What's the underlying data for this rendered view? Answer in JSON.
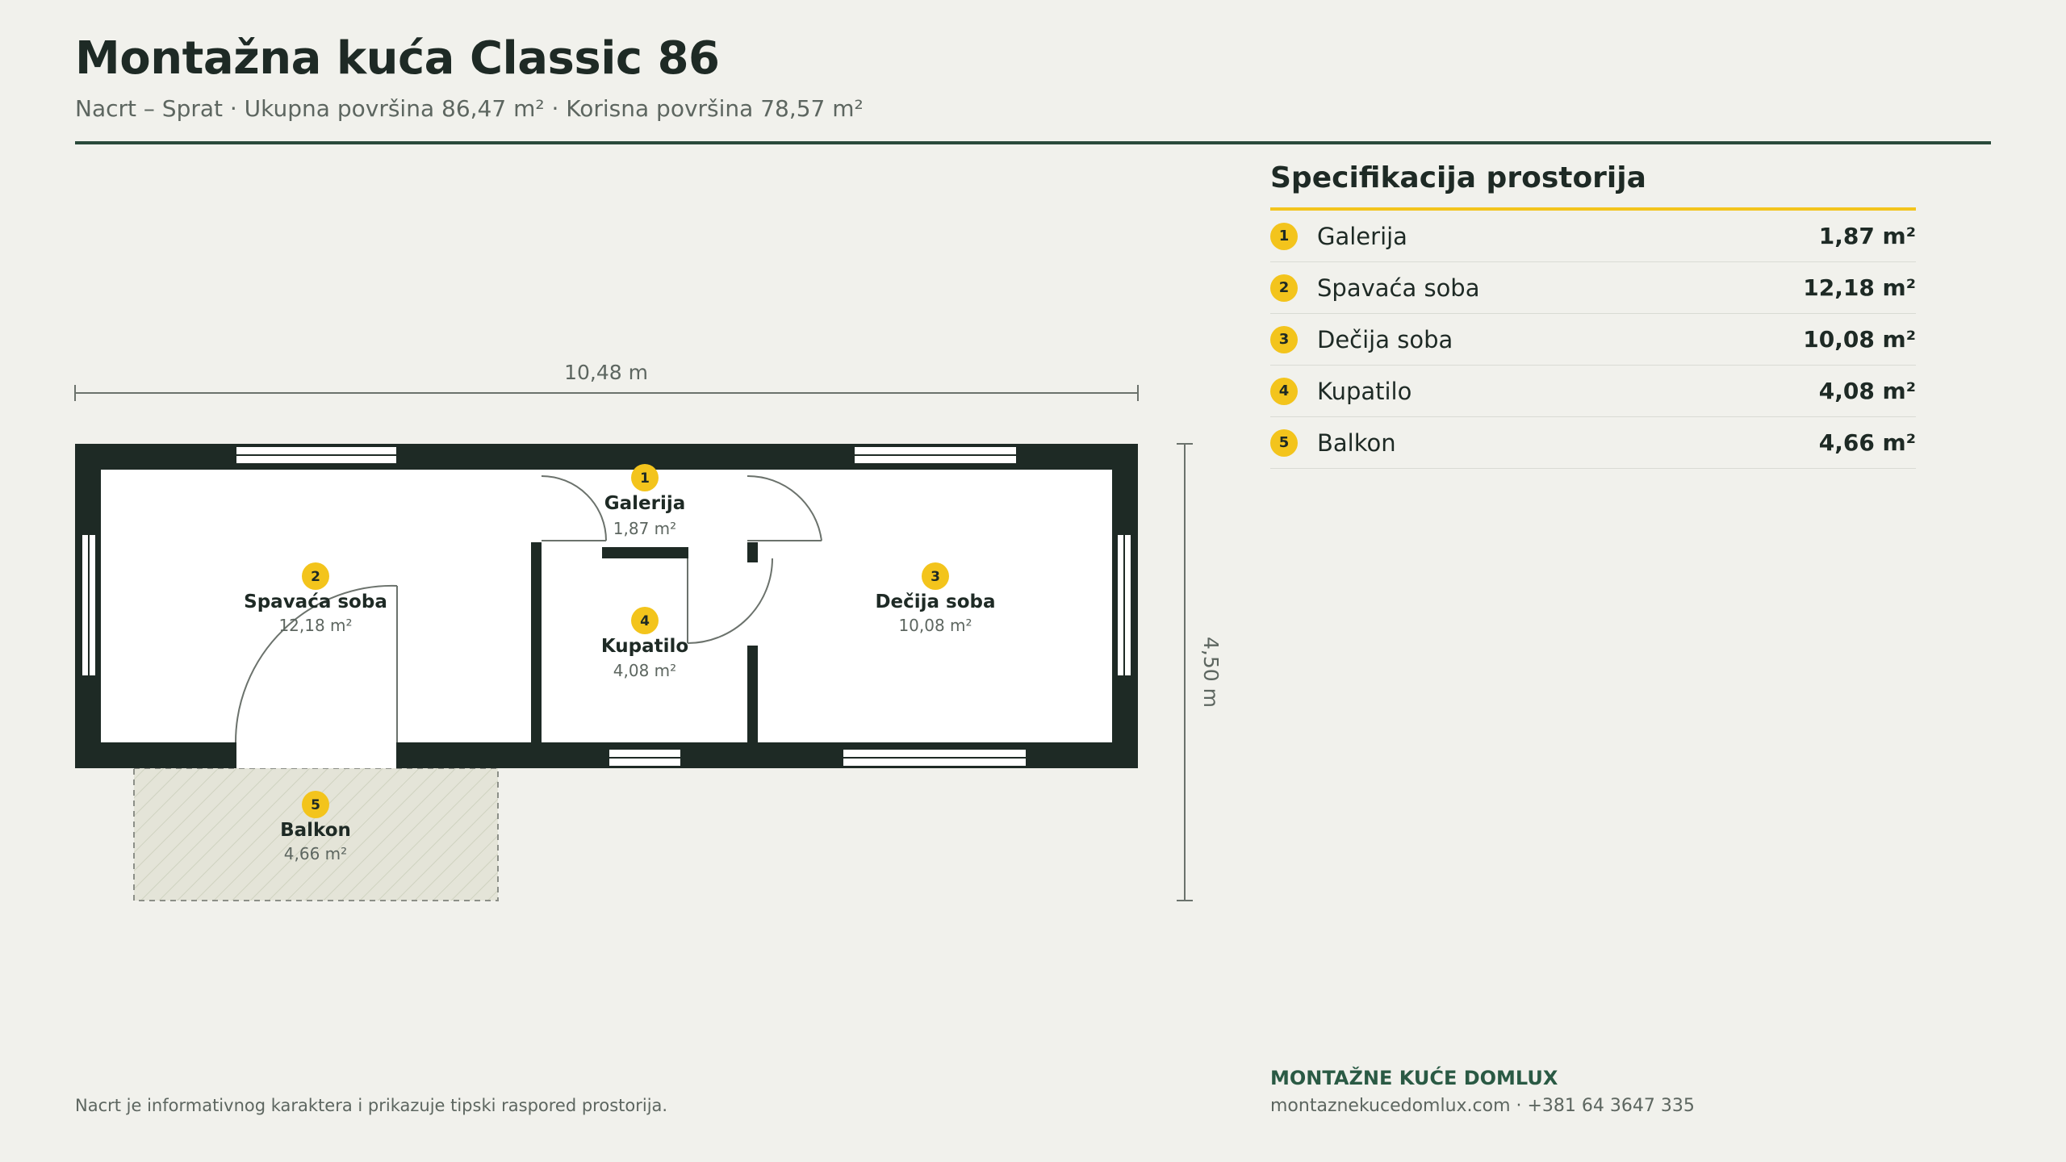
{
  "header": {
    "title": "Montažna kuća Classic 86",
    "subtitle": "Nacrt – Sprat · Ukupna površina 86,47 m² · Korisna površina 78,57 m²"
  },
  "plan": {
    "width_label": "10,48 m",
    "depth_label": "4,50 m",
    "rooms": [
      {
        "num": "1",
        "name": "Galerija",
        "area": "1,87 m²"
      },
      {
        "num": "2",
        "name": "Spavaća soba",
        "area": "12,18 m²"
      },
      {
        "num": "3",
        "name": "Dečija soba",
        "area": "10,08 m²"
      },
      {
        "num": "4",
        "name": "Kupatilo",
        "area": "4,08 m²"
      },
      {
        "num": "5",
        "name": "Balkon",
        "area": "4,66 m²"
      }
    ]
  },
  "spec": {
    "title": "Specifikacija prostorija",
    "rows": [
      {
        "num": "1",
        "name": "Galerija",
        "area": "1,87 m²"
      },
      {
        "num": "2",
        "name": "Spavaća soba",
        "area": "12,18 m²"
      },
      {
        "num": "3",
        "name": "Dečija soba",
        "area": "10,08 m²"
      },
      {
        "num": "4",
        "name": "Kupatilo",
        "area": "4,08 m²"
      },
      {
        "num": "5",
        "name": "Balkon",
        "area": "4,66 m²"
      }
    ]
  },
  "footer": {
    "note": "Nacrt je informativnog karaktera i prikazuje tipski raspored prostorija.",
    "brand": "MONTAŽNE KUĆE DOMLUX",
    "contact": "montaznekucedomlux.com · +381 64 3647 335"
  },
  "colors": {
    "background": "#f1f1ec",
    "wall": "#1e2a25",
    "accent": "#f3c41c",
    "rule": "#2a4a3b",
    "brand": "#2a5a44"
  }
}
